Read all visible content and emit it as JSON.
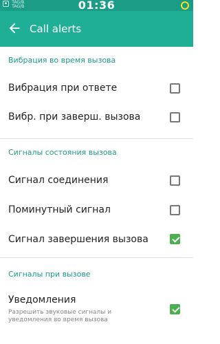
{
  "status_bar": {
    "time": "01:36",
    "carrier_line1": "TAG/B",
    "carrier_line2": "TAG/B",
    "sim_icon": "sim-icon",
    "battery_icon": "battery-ring-icon",
    "battery_color": "#f2e21b"
  },
  "app_bar": {
    "title": "Call alerts",
    "back_icon": "arrow-left-icon",
    "color": "#1fae96"
  },
  "sections": [
    {
      "header": "Вибрация во время вызова",
      "items": [
        {
          "label": "Вибрация при ответе",
          "checked": false
        },
        {
          "label": "Вибр. при заверш. вызова",
          "checked": false
        }
      ]
    },
    {
      "header": "Сигналы состояния вызова",
      "items": [
        {
          "label": "Сигнал соединения",
          "checked": false
        },
        {
          "label": "Поминутный сигнал",
          "checked": false
        },
        {
          "label": "Сигнал завершения вызова",
          "checked": true
        }
      ]
    },
    {
      "header": "Сигналы при вызове",
      "items": [
        {
          "label": "Уведомления",
          "sub": "Разрешить звуковые сигналы и уведомления во время вызова",
          "checked": true
        }
      ]
    }
  ],
  "accent_color": "#1a9c87",
  "checkbox_checked_color": "#4caf50"
}
